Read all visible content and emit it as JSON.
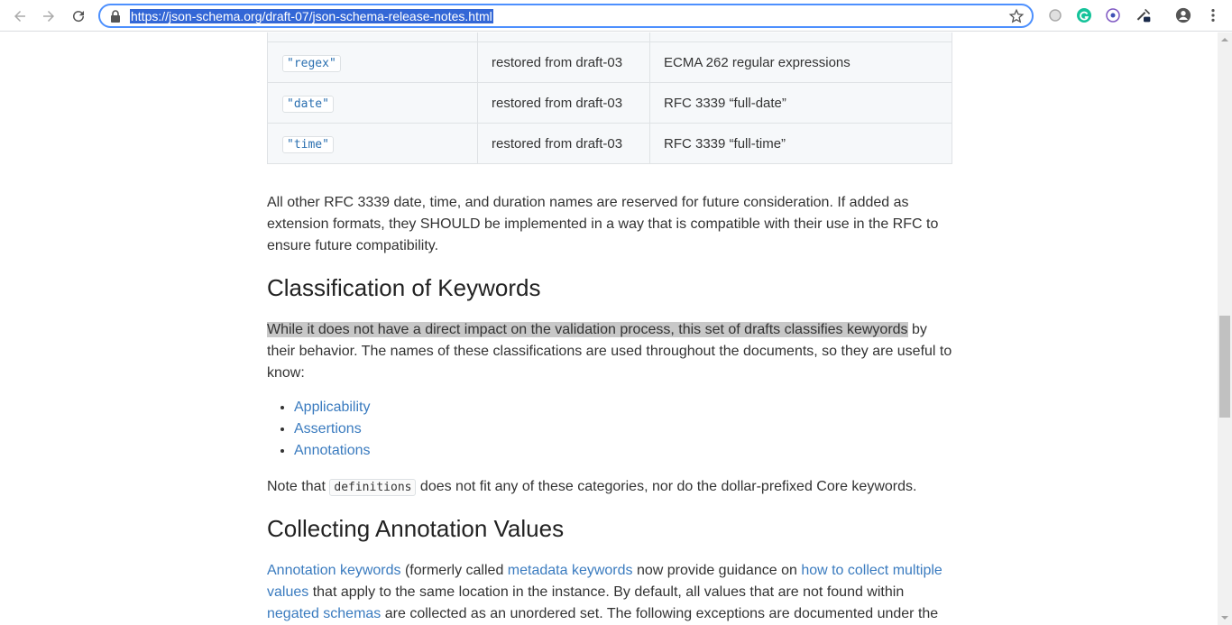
{
  "browser": {
    "url": "https://json-schema.org/draft-07/json-schema-release-notes.html"
  },
  "table": {
    "rows": [
      {
        "format": "\"regex\"",
        "status": "restored from draft-03",
        "description": "ECMA 262 regular expressions"
      },
      {
        "format": "\"date\"",
        "status": "restored from draft-03",
        "description": "RFC 3339 “full-date”"
      },
      {
        "format": "\"time\"",
        "status": "restored from draft-03",
        "description": "RFC 3339 “full-time”"
      }
    ]
  },
  "para_reserved": "All other RFC 3339 date, time, and duration names are reserved for future consideration. If added as extension formats, they SHOULD be implemented in a way that is compatible with their use in the RFC to ensure future compatibility.",
  "section_classification": {
    "heading": "Classification of Keywords",
    "para_highlighted": "While it does not have a direct impact on the validation process, this set of drafts classifies kewyords",
    "para_rest": " by their behavior. The names of these classifications are used throughout the documents, so they are useful to know:",
    "items": [
      "Applicability",
      "Assertions",
      "Annotations"
    ],
    "note_before": "Note that ",
    "note_code": "definitions",
    "note_after": " does not fit any of these categories, nor do the dollar-prefixed Core keywords."
  },
  "section_collecting": {
    "heading": "Collecting Annotation Values",
    "link_annotation_keywords": "Annotation keywords",
    "text_formerly": " (formerly called ",
    "link_metadata_keywords": "metadata keywords",
    "text_provide": " now provide guidance on ",
    "link_how_to_collect": "how to collect multiple values",
    "text_apply": " that apply to the same location in the instance. By default, all values that are not found within ",
    "link_negated_schemas": "negated schemas",
    "text_collected": " are collected as an unordered set. The following exceptions are documented under the"
  }
}
